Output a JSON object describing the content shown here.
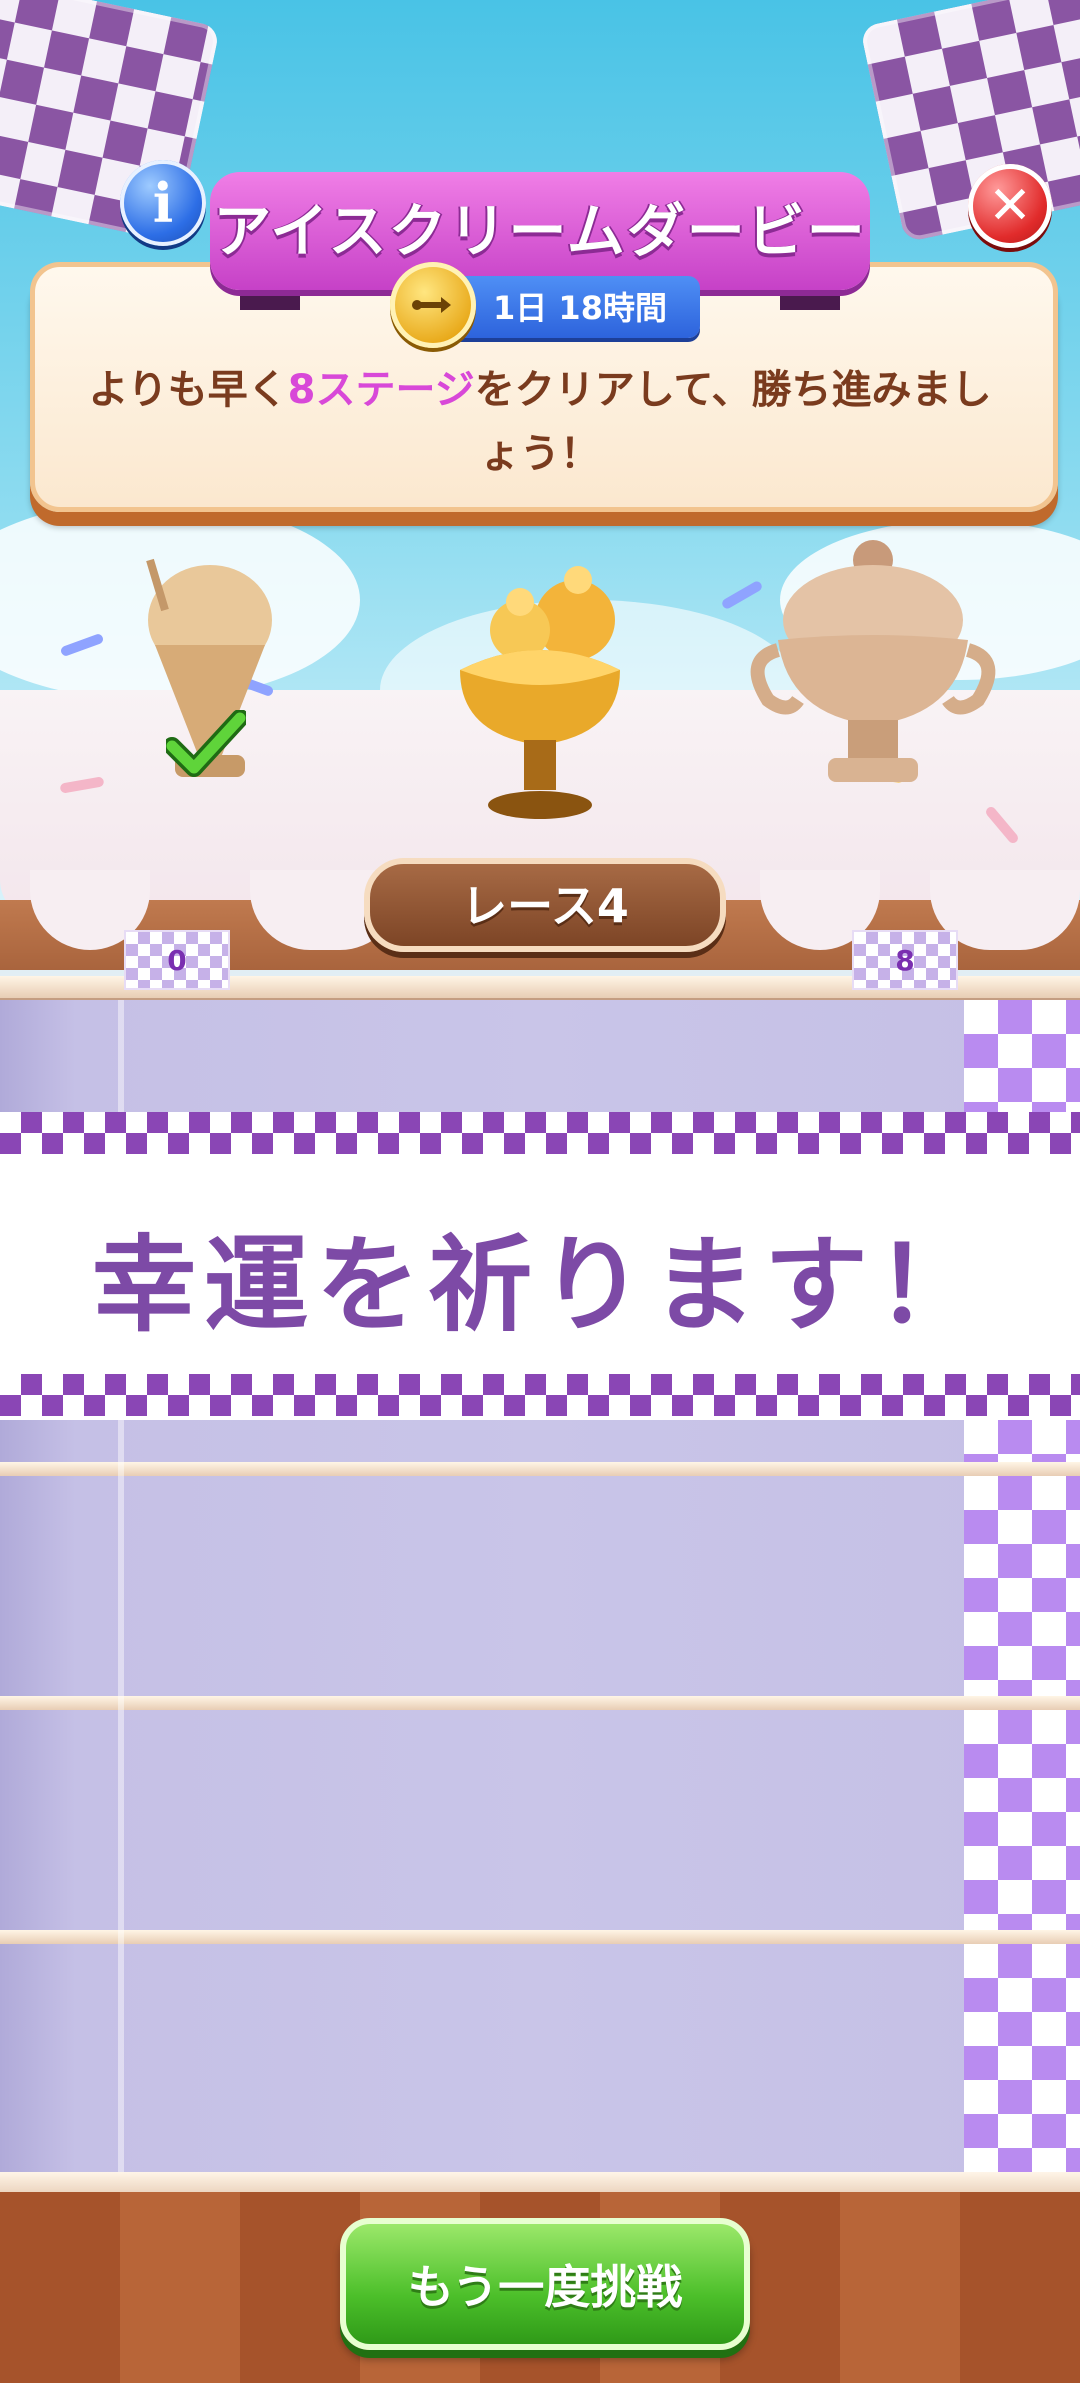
{
  "header": {
    "title": "アイスクリームダービー",
    "timer": "1日 18時間",
    "description_prefix": "よりも早く",
    "description_highlight": "8ステージ",
    "description_suffix": "をクリアして、勝ち進みましょう！",
    "info_icon": "info-icon",
    "close_icon": "close-icon"
  },
  "race": {
    "label": "レース4",
    "start_marker": "0",
    "finish_marker": "8"
  },
  "banner": {
    "message": "幸運を祈ります！"
  },
  "footer": {
    "retry_label": "もう一度挑戦"
  },
  "trophies": [
    {
      "name": "cone-trophy",
      "completed": true
    },
    {
      "name": "sundae-trophy",
      "current": true
    },
    {
      "name": "cup-trophy",
      "locked": true
    }
  ],
  "colors": {
    "title_ribbon": "#c641c7",
    "highlight": "#d848d8",
    "banner_text": "#7d4aa6",
    "retry_button": "#4cbf2a"
  }
}
